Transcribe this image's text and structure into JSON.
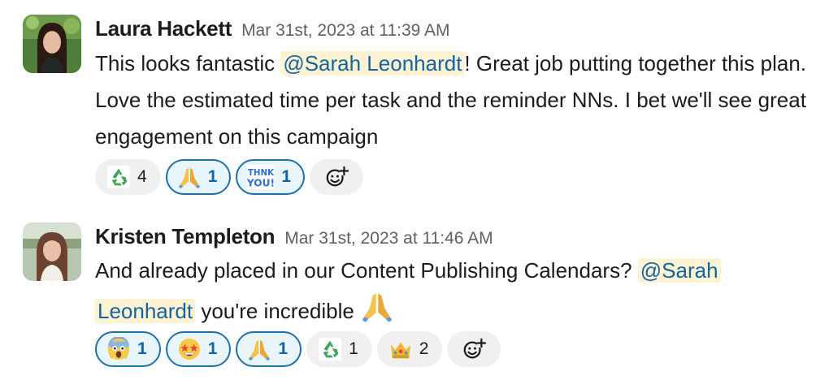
{
  "messages": [
    {
      "author": "Laura Hackett",
      "timestamp": "Mar 31st, 2023 at 11:39 AM",
      "text_before": "This looks fantastic ",
      "mention": "@Sarah Leonhardt",
      "text_after": "! Great job putting together this plan. Love the estimated time per task and the reminder NNs. I bet we'll see great engagement on this campaign",
      "reactions": [
        {
          "emoji": "recycle",
          "count": "4",
          "mine": false
        },
        {
          "emoji": "folded-hands",
          "count": "1",
          "mine": true
        },
        {
          "emoji": "thank-you",
          "count": "1",
          "mine": true
        }
      ]
    },
    {
      "author": "Kristen Templeton",
      "timestamp": "Mar 31st, 2023 at 11:46 AM",
      "text_before": "And already placed in our Content Publishing Calendars? ",
      "mention_part1": "@Sarah",
      "mention_part2": "Leonhardt",
      "text_after": " you're incredible",
      "inline_emoji": "folded-hands",
      "reactions": [
        {
          "emoji": "screaming-face",
          "count": "1",
          "mine": true
        },
        {
          "emoji": "star-struck",
          "count": "1",
          "mine": true
        },
        {
          "emoji": "folded-hands",
          "count": "1",
          "mine": true
        },
        {
          "emoji": "recycle",
          "count": "1",
          "mine": false
        },
        {
          "emoji": "crown",
          "count": "2",
          "mine": false
        }
      ]
    }
  ],
  "icons": {
    "add_reaction": "add-reaction-icon"
  },
  "colors": {
    "mention_bg": "#fdf2d2",
    "mention_text": "#1264a3",
    "reaction_mine_border": "#1d6fa8",
    "reaction_mine_bg": "#e8f5fa",
    "reaction_bg": "#f0f0f0"
  }
}
